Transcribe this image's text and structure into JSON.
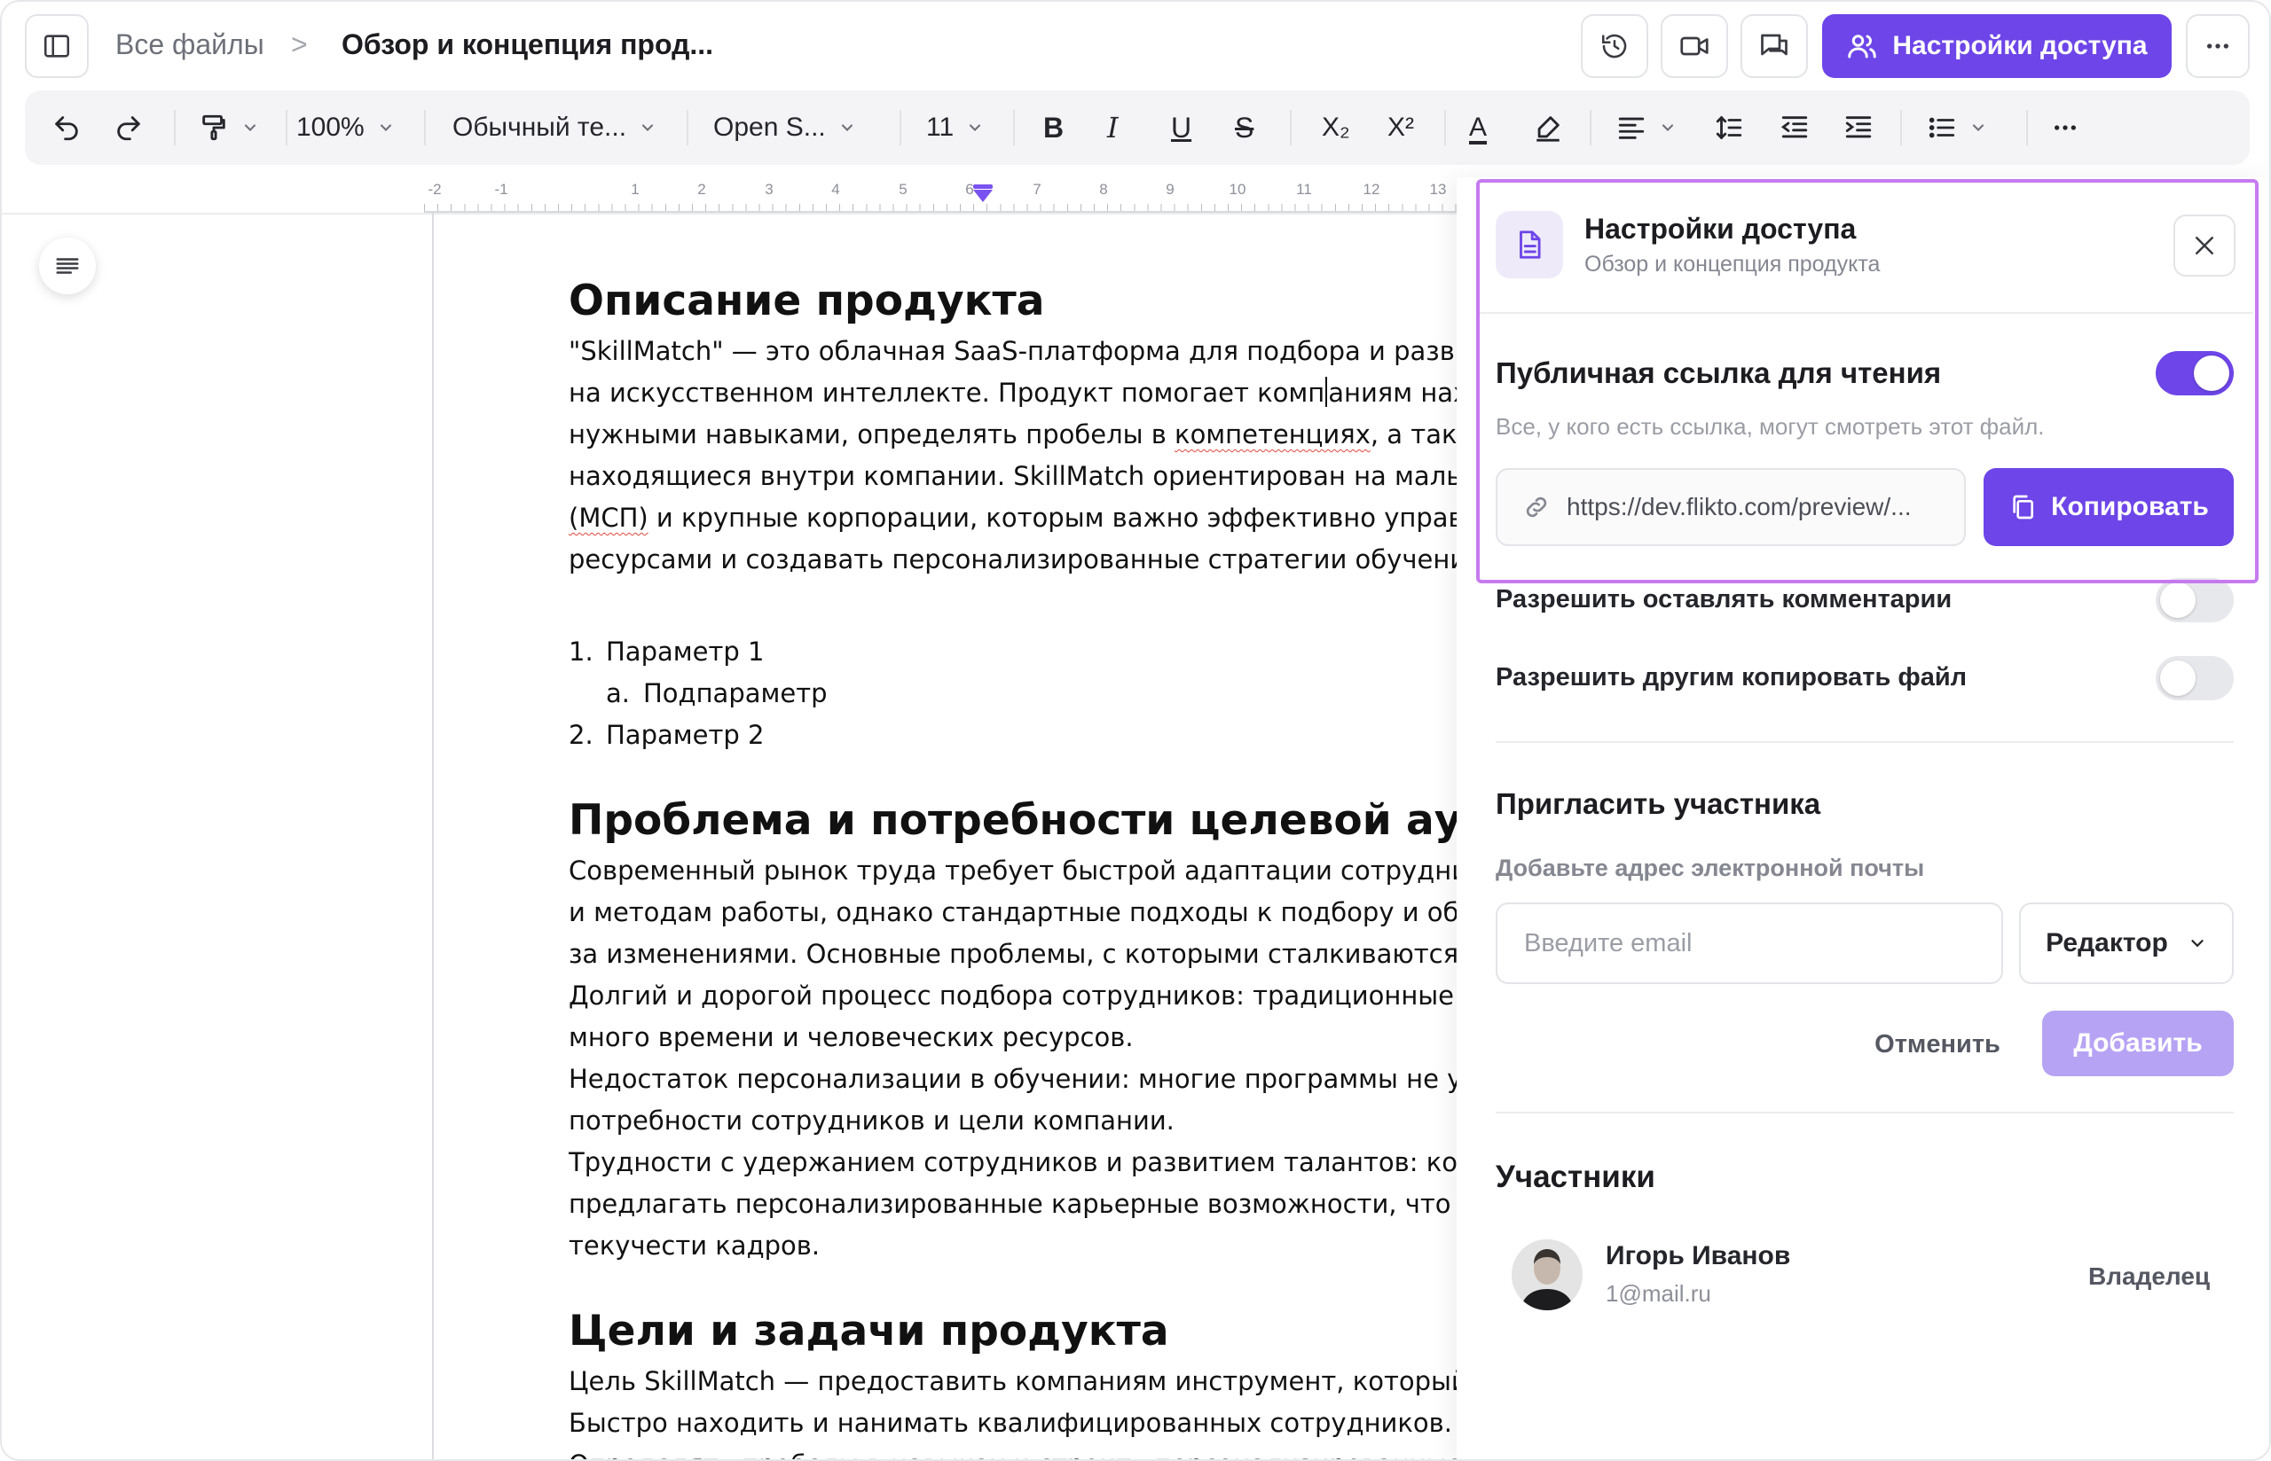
{
  "header": {
    "breadcrumb_root": "Все файлы",
    "breadcrumb_separator": ">",
    "document_title": "Обзор и концепция прод...",
    "access_button_label": "Настройки доступа"
  },
  "toolbar": {
    "zoom": "100%",
    "paragraph_style": "Обычный те...",
    "font_family": "Open S...",
    "font_size": "11",
    "bold": "B",
    "italic": "I",
    "underline": "U",
    "strikethrough": "S",
    "subscript": "X₂",
    "superscript": "X²",
    "text_color_letter": "A"
  },
  "ruler": {
    "labels": [
      "-2",
      "-1",
      "1",
      "2",
      "3",
      "4",
      "5",
      "6",
      "7",
      "8",
      "9",
      "10",
      "11",
      "12",
      "13"
    ]
  },
  "document": {
    "h1": "Описание продукта",
    "p1": [
      "\"SkillMatch\" — это облачная SaaS-платформа для подбора и развития т",
      "на искусственном интеллекте. Продукт помогает компаниям находить",
      "нужными навыками, определять пробелы в компетенциях, а также ра",
      "находящиеся внутри компании. SkillMatch ориентирован на малые и с",
      "(МСП) и крупные корпорации, которым важно эффективно управлять",
      "ресурсами и создавать персонализированные стратегии обучения со"
    ],
    "p1_line2_before_cursor": "на искусственном интеллекте. Продукт помогает комп",
    "p1_line2_after_cursor": "аниям находить",
    "p1_line3_before": "нужными навыками, определять пробелы в ",
    "p1_line3_misspelled": "компетенциях",
    "p1_line3_after": ", а также ра",
    "p1_line5_misspelled": "(МСП)",
    "p1_line5_after": " и крупные корпорации, которым важно эффективно управлять",
    "list": [
      {
        "marker": "1.",
        "text": "Параметр 1",
        "level": 0
      },
      {
        "marker": "a.",
        "text": "Подпараметр",
        "level": 1
      },
      {
        "marker": "2.",
        "text": "Параметр 2",
        "level": 0
      }
    ],
    "h2": "Проблема и потребности целевой ауди",
    "p2": [
      "Современный рынок труда требует быстрой адаптации сотрудников к",
      "и методам работы, однако стандартные подходы к подбору и обучени",
      "за изменениями. Основные проблемы, с которыми сталкиваются ком",
      "Долгий и дорогой процесс подбора сотрудников: традиционные мето",
      "много времени и человеческих ресурсов.",
      "Недостаток персонализации в обучении: многие программы не учиты",
      "потребности сотрудников и цели компании.",
      "Трудности с удержанием сотрудников и развитием талантов: компани",
      "предлагать персонализированные карьерные возможности, что прив",
      "текучести кадров."
    ],
    "h3": "Цели и задачи продукта",
    "p3": [
      "Цель SkillMatch — предоставить компаниям инструмент, который пом",
      "Быстро находить и нанимать квалифицированных сотрудников.",
      "Определять пробелы в навыках и строить персонализированные пла"
    ]
  },
  "panel": {
    "title": "Настройки доступа",
    "subtitle": "Обзор и концепция продукта",
    "public_link_title": "Публичная ссылка для чтения",
    "public_link_enabled": true,
    "public_link_description": "Все, у кого есть ссылка, могут смотреть этот файл.",
    "link_url": "https://dev.flikto.com/preview/...",
    "copy_label": "Копировать",
    "allow_comments_label": "Разрешить оставлять комментарии",
    "allow_comments_enabled": false,
    "allow_copy_label": "Разрешить другим копировать файл",
    "allow_copy_enabled": false,
    "invite_title": "Пригласить участника",
    "invite_subtitle": "Добавьте адрес электронной почты",
    "email_placeholder": "Введите email",
    "email_value": "",
    "role_selected": "Редактор",
    "cancel_label": "Отменить",
    "add_label": "Добавить",
    "members_title": "Участники",
    "members": [
      {
        "name": "Игорь Иванов",
        "email": "1@mail.ru",
        "role": "Владелец"
      }
    ]
  },
  "colors": {
    "accent": "#6d45e8",
    "accent_disabled": "#b7a3f4",
    "highlight_border": "#c67aef"
  }
}
